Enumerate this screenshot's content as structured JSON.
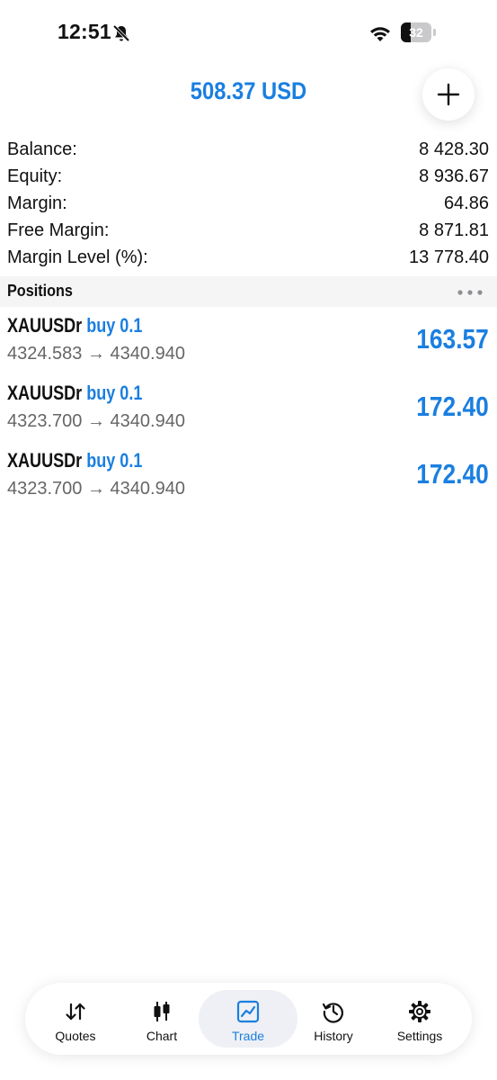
{
  "status_bar": {
    "time": "12:51",
    "battery_percent": "32",
    "battery_level": 0.32
  },
  "header": {
    "title": "508.37 USD",
    "add_icon": "plus-icon"
  },
  "summary": [
    {
      "label": "Balance:",
      "value": "8 428.30"
    },
    {
      "label": "Equity:",
      "value": "8 936.67"
    },
    {
      "label": "Margin:",
      "value": "64.86"
    },
    {
      "label": "Free Margin:",
      "value": "8 871.81"
    },
    {
      "label": "Margin Level (%):",
      "value": "13 778.40"
    }
  ],
  "positions": {
    "title": "Positions",
    "items": [
      {
        "symbol": "XAUUSDr",
        "side": "buy 0.1",
        "prices": "4324.583 → 4340.940",
        "profit": "163.57"
      },
      {
        "symbol": "XAUUSDr",
        "side": "buy 0.1",
        "prices": "4323.700 → 4340.940",
        "profit": "172.40"
      },
      {
        "symbol": "XAUUSDr",
        "side": "buy 0.1",
        "prices": "4323.700 → 4340.940",
        "profit": "172.40"
      }
    ]
  },
  "tabs": [
    {
      "label": "Quotes",
      "icon": "quotes-arrows-icon"
    },
    {
      "label": "Chart",
      "icon": "candlestick-icon"
    },
    {
      "label": "Trade",
      "icon": "trade-chart-icon",
      "active": true
    },
    {
      "label": "History",
      "icon": "history-clock-icon"
    },
    {
      "label": "Settings",
      "icon": "gear-icon"
    }
  ],
  "colors": {
    "accent": "#1a7fe0",
    "muted_text": "#666666",
    "section_bg": "#f5f5f6"
  }
}
